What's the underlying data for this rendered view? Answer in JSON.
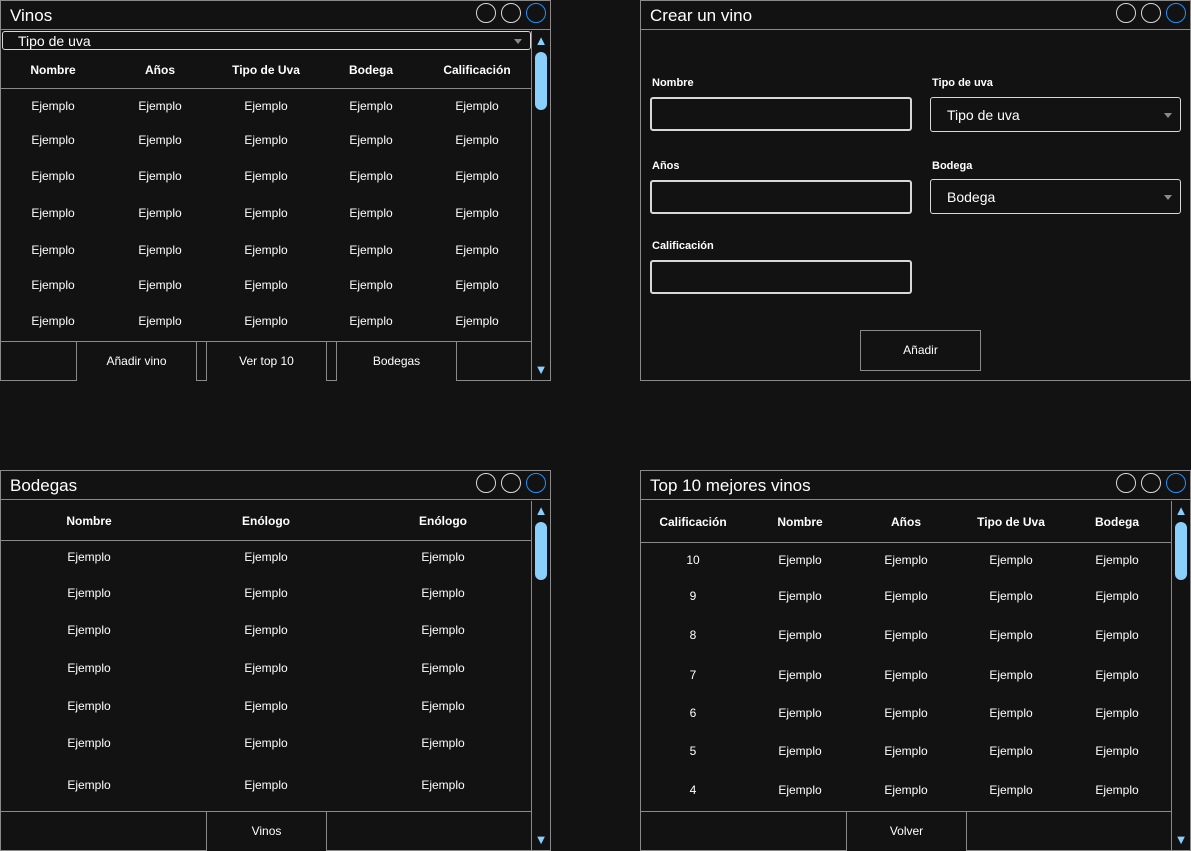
{
  "vinos": {
    "title": "Vinos",
    "filter": "Tipo de uva",
    "headers": [
      "Nombre",
      "Años",
      "Tipo de Uva",
      "Bodega",
      "Calificación"
    ],
    "rows": [
      [
        "Ejemplo",
        "Ejemplo",
        "Ejemplo",
        "Ejemplo",
        "Ejemplo"
      ],
      [
        "Ejemplo",
        "Ejemplo",
        "Ejemplo",
        "Ejemplo",
        "Ejemplo"
      ],
      [
        "Ejemplo",
        "Ejemplo",
        "Ejemplo",
        "Ejemplo",
        "Ejemplo"
      ],
      [
        "Ejemplo",
        "Ejemplo",
        "Ejemplo",
        "Ejemplo",
        "Ejemplo"
      ],
      [
        "Ejemplo",
        "Ejemplo",
        "Ejemplo",
        "Ejemplo",
        "Ejemplo"
      ],
      [
        "Ejemplo",
        "Ejemplo",
        "Ejemplo",
        "Ejemplo",
        "Ejemplo"
      ],
      [
        "Ejemplo",
        "Ejemplo",
        "Ejemplo",
        "Ejemplo",
        "Ejemplo"
      ]
    ],
    "buttons": {
      "add": "Añadir vino",
      "top": "Ver top 10",
      "bodegas": "Bodegas"
    }
  },
  "crear": {
    "title": "Crear un vino",
    "nombre_label": "Nombre",
    "tipo_label": "Tipo de uva",
    "tipo_value": "Tipo de uva",
    "anos_label": "Años",
    "bodega_label": "Bodega",
    "bodega_value": "Bodega",
    "calif_label": "Calificación",
    "submit": "Añadir"
  },
  "bodegas": {
    "title": "Bodegas",
    "headers": [
      "Nombre",
      "Enólogo",
      "Enólogo"
    ],
    "rows": [
      [
        "Ejemplo",
        "Ejemplo",
        "Ejemplo"
      ],
      [
        "Ejemplo",
        "Ejemplo",
        "Ejemplo"
      ],
      [
        "Ejemplo",
        "Ejemplo",
        "Ejemplo"
      ],
      [
        "Ejemplo",
        "Ejemplo",
        "Ejemplo"
      ],
      [
        "Ejemplo",
        "Ejemplo",
        "Ejemplo"
      ],
      [
        "Ejemplo",
        "Ejemplo",
        "Ejemplo"
      ],
      [
        "Ejemplo",
        "Ejemplo",
        "Ejemplo"
      ]
    ],
    "button": "Vinos"
  },
  "top10": {
    "title": "Top 10 mejores vinos",
    "headers": [
      "Calificación",
      "Nombre",
      "Años",
      "Tipo de Uva",
      "Bodega"
    ],
    "rows": [
      [
        "10",
        "Ejemplo",
        "Ejemplo",
        "Ejemplo",
        "Ejemplo"
      ],
      [
        "9",
        "Ejemplo",
        "Ejemplo",
        "Ejemplo",
        "Ejemplo"
      ],
      [
        "8",
        "Ejemplo",
        "Ejemplo",
        "Ejemplo",
        "Ejemplo"
      ],
      [
        "7",
        "Ejemplo",
        "Ejemplo",
        "Ejemplo",
        "Ejemplo"
      ],
      [
        "6",
        "Ejemplo",
        "Ejemplo",
        "Ejemplo",
        "Ejemplo"
      ],
      [
        "5",
        "Ejemplo",
        "Ejemplo",
        "Ejemplo",
        "Ejemplo"
      ],
      [
        "4",
        "Ejemplo",
        "Ejemplo",
        "Ejemplo",
        "Ejemplo"
      ]
    ],
    "button": "Volver"
  },
  "icons": {
    "scroll_up": "triangle-up-icon",
    "scroll_down": "triangle-down-icon",
    "window_control": "circle-icon"
  },
  "colors": {
    "background": "#121212",
    "border": "#8a8a8a",
    "accent": "#1e90ff",
    "scrollbar": "#8ad0ff"
  }
}
